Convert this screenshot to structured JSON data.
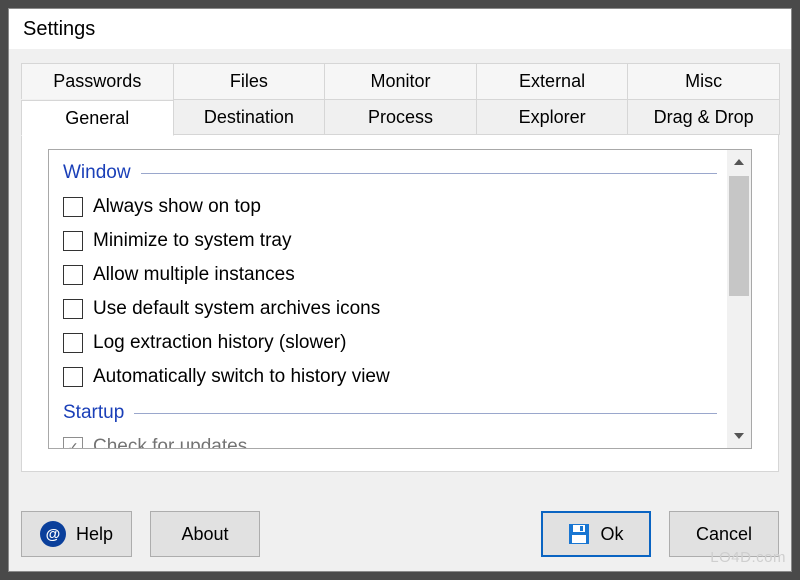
{
  "title": "Settings",
  "tabs_row1": [
    "Passwords",
    "Files",
    "Monitor",
    "External",
    "Misc"
  ],
  "tabs_row2": [
    "General",
    "Destination",
    "Process",
    "Explorer",
    "Drag & Drop"
  ],
  "active_tab": "General",
  "group1": {
    "title": "Window",
    "items": [
      {
        "label": "Always show on top",
        "checked": false
      },
      {
        "label": "Minimize to system tray",
        "checked": false
      },
      {
        "label": "Allow multiple instances",
        "checked": false
      },
      {
        "label": "Use default system archives icons",
        "checked": false
      },
      {
        "label": "Log extraction history (slower)",
        "checked": false
      },
      {
        "label": "Automatically switch to history view",
        "checked": false
      }
    ]
  },
  "group2": {
    "title": "Startup",
    "items": [
      {
        "label": "Check for updates",
        "checked": true
      }
    ]
  },
  "buttons": {
    "help": "Help",
    "about": "About",
    "ok": "Ok",
    "cancel": "Cancel"
  },
  "watermark": "LO4D.com"
}
